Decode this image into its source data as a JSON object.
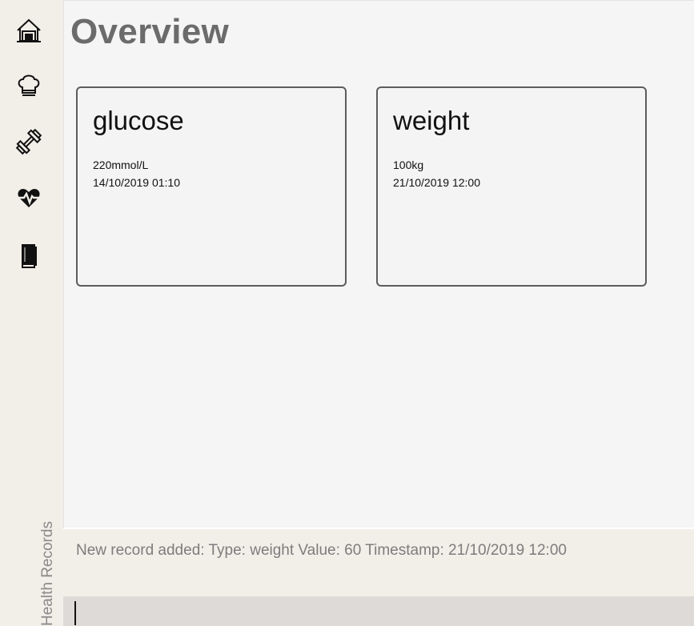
{
  "sidebar": {
    "items": [
      {
        "name": "home",
        "icon": "home-icon"
      },
      {
        "name": "diet",
        "icon": "chef-hat-icon"
      },
      {
        "name": "exercise",
        "icon": "dumbbell-icon"
      },
      {
        "name": "health",
        "icon": "heartbeat-icon"
      },
      {
        "name": "diary",
        "icon": "book-icon"
      }
    ],
    "label": "Health Records"
  },
  "main": {
    "title": "Overview",
    "cards": [
      {
        "title": "glucose",
        "value": "220mmol/L",
        "timestamp": "14/10/2019 01:10"
      },
      {
        "title": "weight",
        "value": "100kg",
        "timestamp": "21/10/2019 12:00"
      }
    ]
  },
  "result": {
    "text": "New record added: Type: weight Value: 60 Timestamp: 21/10/2019 12:00"
  },
  "command": {
    "value": ""
  },
  "colors": {
    "sidebar_bg": "#f2eee8",
    "main_bg": "#f5f5f5",
    "command_bg": "#dddad7",
    "card_border": "#5c5c5c"
  }
}
